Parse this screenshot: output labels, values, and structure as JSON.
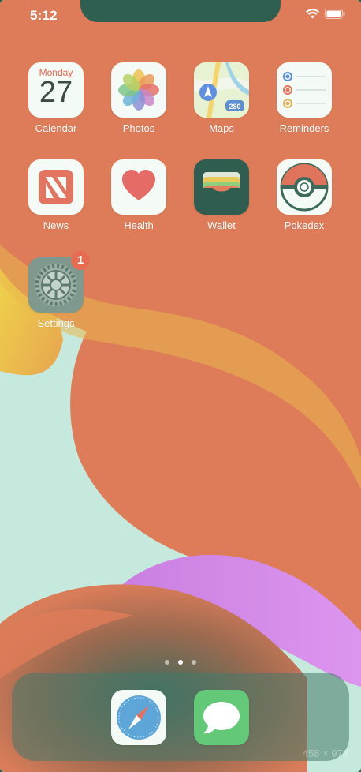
{
  "status_bar": {
    "time": "5:12",
    "icons": [
      "wifi-icon",
      "battery-icon"
    ]
  },
  "home": {
    "apps": [
      {
        "name": "Calendar",
        "icon": "calendar-icon",
        "calendar_day": "Monday",
        "calendar_date": "27"
      },
      {
        "name": "Photos",
        "icon": "photos-icon"
      },
      {
        "name": "Maps",
        "icon": "maps-icon",
        "road_sign": "280"
      },
      {
        "name": "Reminders",
        "icon": "reminders-icon"
      },
      {
        "name": "News",
        "icon": "news-icon"
      },
      {
        "name": "Health",
        "icon": "health-icon"
      },
      {
        "name": "Wallet",
        "icon": "wallet-icon"
      },
      {
        "name": "Pokedex",
        "icon": "pokeball-icon"
      },
      {
        "name": "Settings",
        "icon": "gear-icon",
        "badge": "1"
      }
    ]
  },
  "page_indicator": {
    "pages": 3,
    "current": 2
  },
  "dock": {
    "apps": [
      {
        "name": "Safari",
        "icon": "compass-icon"
      },
      {
        "name": "Messages",
        "icon": "speech-bubble-icon"
      }
    ]
  },
  "watermark": "458 × 978",
  "colors": {
    "wallpaper_base": "#c5e9dc",
    "wallpaper_orange": "#de7b58",
    "wallpaper_yellow": "#ecd24a",
    "wallpaper_purple": "#d58ae8",
    "badge": "#e86c52",
    "accent_text": "#ffffff"
  }
}
